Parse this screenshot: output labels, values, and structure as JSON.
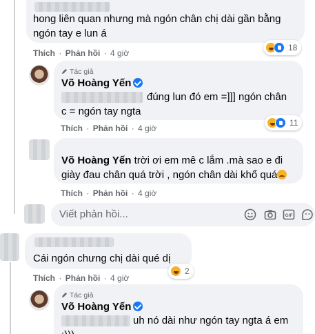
{
  "comment1": {
    "text": "hong liên quan nhưng mà ngón chân chị dài gần bằng ngón tay e lun á",
    "line1": "hong liên quan nhưng mà ngón chân chị dài gần bằng",
    "line2": "ngón tay e lun á",
    "like_label": "Thích",
    "reply_label": "Phản hồi",
    "time": "4 giờ",
    "reaction_count": "18"
  },
  "reply1": {
    "author_tag": "Tác giả",
    "author": "Võ Hoàng Yến",
    "line1": "đúng lun đó em =]]] ngón chân",
    "line2": "c = ngón tay ngta",
    "like_label": "Thích",
    "reply_label": "Phản hồi",
    "time": "4 giờ",
    "reaction_count": "11"
  },
  "reply2": {
    "author": "Võ Hoàng Yến",
    "line1": "trời ơi em mê c lắm .mà sao e đi",
    "line2": "giày đau chân quá trời , ngón chân dài khổ quá",
    "like_label": "Thích",
    "reply_label": "Phản hồi",
    "time": "4 giờ"
  },
  "reply_input": {
    "placeholder": "Viết phản hồi...",
    "icons": [
      "smiley-icon",
      "camera-icon",
      "gif-icon",
      "sticker-icon"
    ]
  },
  "comment2": {
    "text": "Cái ngón chưng chị dài qué dị",
    "like_label": "Thích",
    "reply_label": "Phản hồi",
    "time": "4 giờ",
    "reaction_count": "2"
  },
  "reply3": {
    "author_tag": "Tác giả",
    "author": "Võ Hoàng Yến",
    "line1": "uh nó dài như ngón tay ngta á em",
    "line2": ":)))"
  },
  "colors": {
    "bubble": "#f0f2f5",
    "secondary_text": "#65676b",
    "verified": "#1877f2"
  }
}
